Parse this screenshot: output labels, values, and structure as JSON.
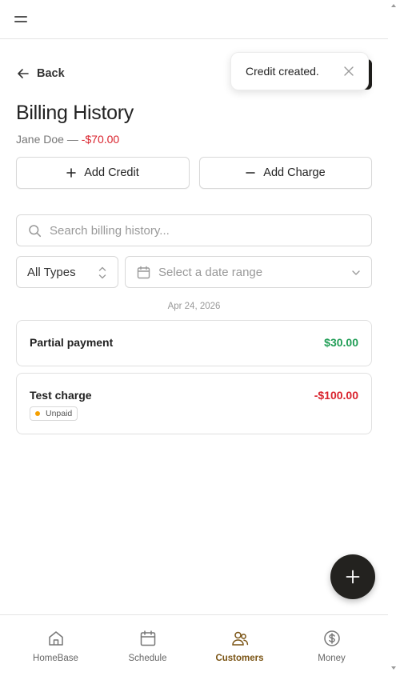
{
  "header": {
    "menu_icon": "hamburger-menu-icon"
  },
  "back": {
    "label": "Back",
    "icon": "arrow-left-icon"
  },
  "toast": {
    "message": "Credit created.",
    "close_icon": "close-icon"
  },
  "page": {
    "title": "Billing History",
    "customer_name": "Jane Doe",
    "separator": " — ",
    "balance": "-$70.00",
    "balance_color": "#d9232d"
  },
  "actions": {
    "add_credit_label": "Add Credit",
    "add_charge_label": "Add Charge"
  },
  "search": {
    "placeholder": "Search billing history...",
    "value": ""
  },
  "filters": {
    "type_selected": "All Types",
    "date_placeholder": "Select a date range"
  },
  "groups": [
    {
      "date": "Apr 24, 2026",
      "entries": [
        {
          "description": "Partial payment",
          "amount": "$30.00",
          "kind": "credit"
        },
        {
          "description": "Test charge",
          "amount": "-$100.00",
          "kind": "charge",
          "status": "Unpaid"
        }
      ]
    }
  ],
  "colors": {
    "positive": "#1f9d55",
    "negative": "#d9232d",
    "accent_active": "#7a5414",
    "fab": "#23221f",
    "badge_dot": "#f5a000"
  },
  "fab": {
    "icon": "plus-icon"
  },
  "nav": {
    "items": [
      {
        "label": "HomeBase",
        "icon": "home-icon",
        "active": false
      },
      {
        "label": "Schedule",
        "icon": "calendar-icon",
        "active": false
      },
      {
        "label": "Customers",
        "icon": "users-icon",
        "active": true
      },
      {
        "label": "Money",
        "icon": "dollar-circle-icon",
        "active": false
      }
    ]
  }
}
